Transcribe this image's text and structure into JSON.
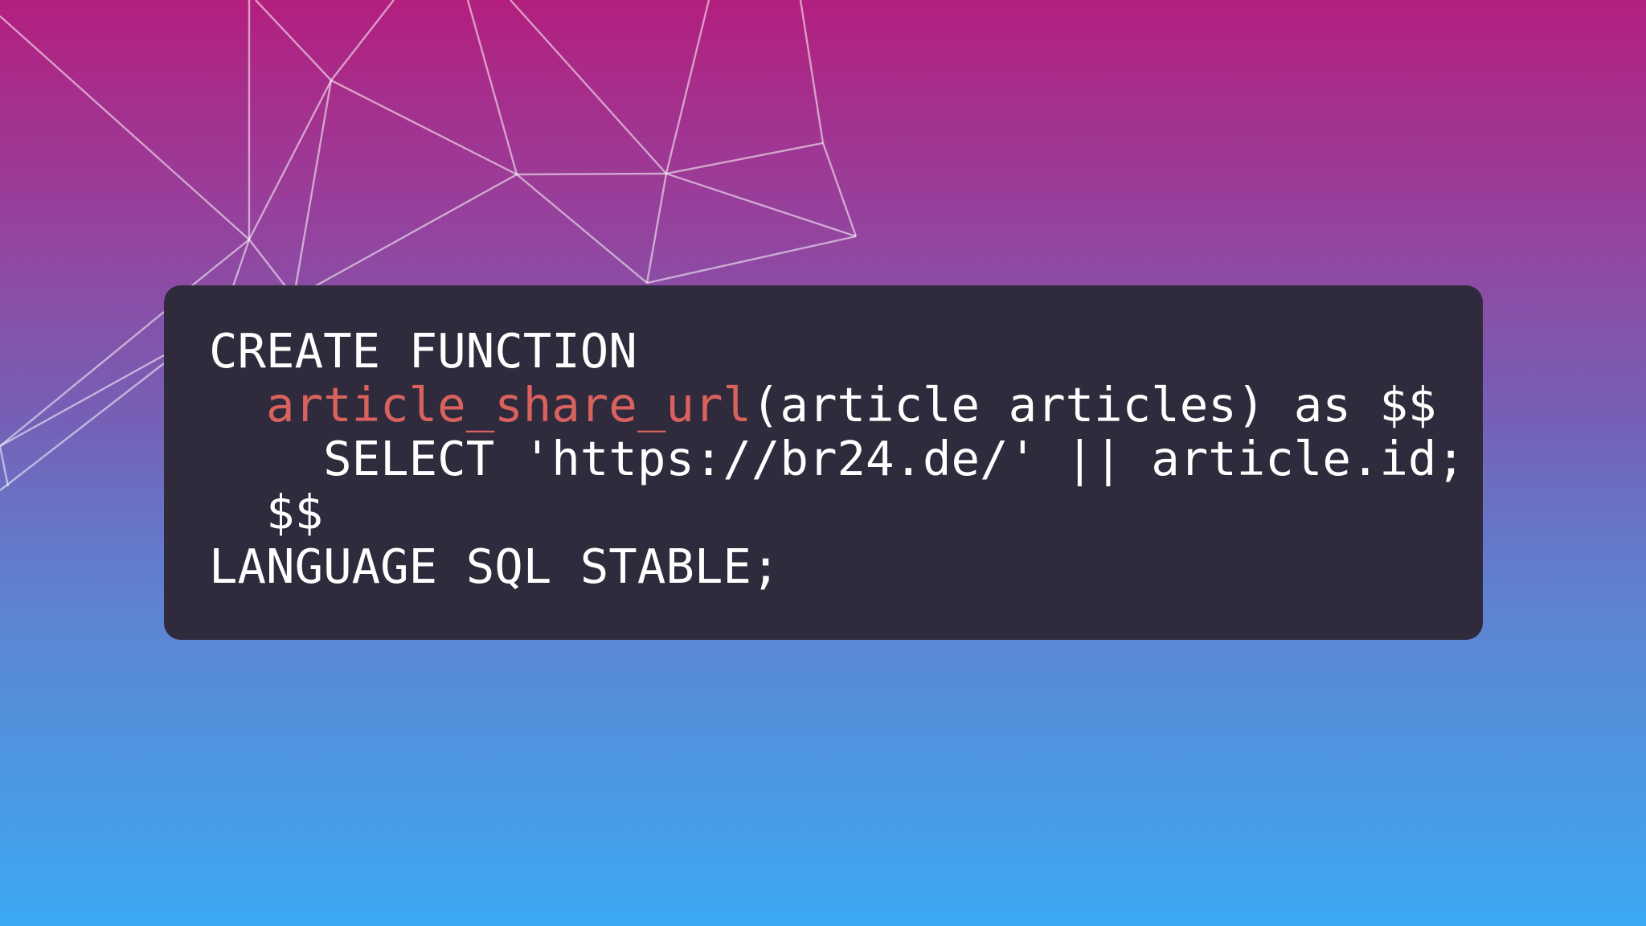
{
  "code": {
    "line1": "CREATE FUNCTION",
    "line2_indent": "  ",
    "line2_fn": "article_share_url",
    "line2_rest": "(article articles) as $$",
    "line3": "    SELECT 'https://br24.de/' || article.id;",
    "line4": "  $$",
    "line5": "LANGUAGE SQL STABLE;"
  },
  "colors": {
    "function_name": "#d9625e",
    "code_text": "#ffffff",
    "card_background": "#2f2b3d"
  }
}
